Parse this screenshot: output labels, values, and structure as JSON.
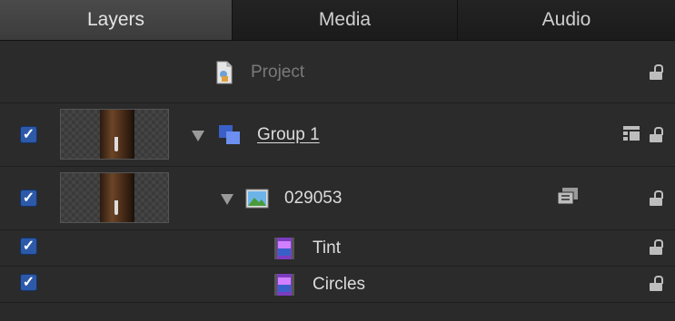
{
  "tabs": [
    {
      "label": "Layers",
      "active": true
    },
    {
      "label": "Media",
      "active": false
    },
    {
      "label": "Audio",
      "active": false
    }
  ],
  "rows": {
    "project": {
      "name": "Project",
      "icon": "project-file-icon"
    },
    "group": {
      "name": "Group 1",
      "icon": "group-icon",
      "checked": true
    },
    "image": {
      "name": "029053",
      "icon": "image-layer-icon",
      "checked": true
    },
    "tint": {
      "name": "Tint",
      "icon": "filter-icon",
      "checked": true
    },
    "circles": {
      "name": "Circles",
      "icon": "filter-icon",
      "checked": true
    }
  },
  "colors": {
    "background": "#2a2a2a",
    "checkbox": "#2c5aa8",
    "group_icon": "#5a7fe0",
    "filter_icon": "#8a46c8"
  }
}
